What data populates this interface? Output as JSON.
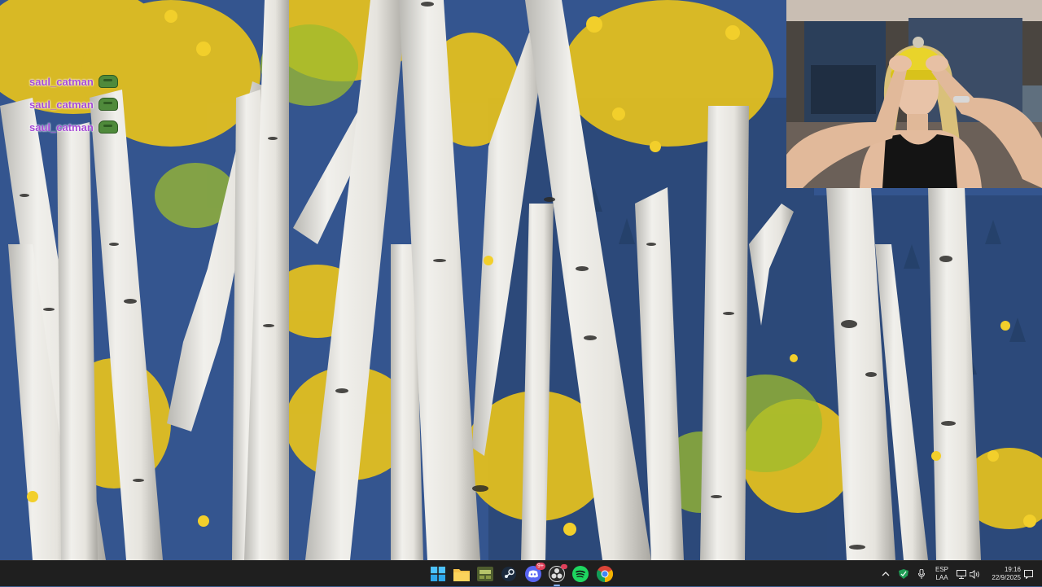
{
  "chat": {
    "messages": [
      {
        "user": "saul_catman",
        "emote": "frog-emote"
      },
      {
        "user": "saul_catman",
        "emote": "frog-emote"
      },
      {
        "user": "saul_catman",
        "emote": "frog-emote"
      }
    ]
  },
  "taskbar": {
    "apps": [
      {
        "name": "windows-start",
        "icon": "windows-icon"
      },
      {
        "name": "file-explorer",
        "icon": "folder-icon"
      },
      {
        "name": "game-app",
        "icon": "game-icon"
      },
      {
        "name": "steam",
        "icon": "steam-icon"
      },
      {
        "name": "discord",
        "icon": "discord-icon",
        "badge": "9+"
      },
      {
        "name": "obs",
        "icon": "obs-icon"
      },
      {
        "name": "spotify",
        "icon": "spotify-icon"
      },
      {
        "name": "chrome",
        "icon": "chrome-icon"
      }
    ],
    "tray": {
      "language_line1": "ESP",
      "language_line2": "LAA",
      "time": "19:16",
      "date": "22/9/2025"
    }
  },
  "colors": {
    "taskbar_bg": "#1f1f1f",
    "chat_username": "#a64ad6",
    "accent": "#8ab4f8"
  }
}
